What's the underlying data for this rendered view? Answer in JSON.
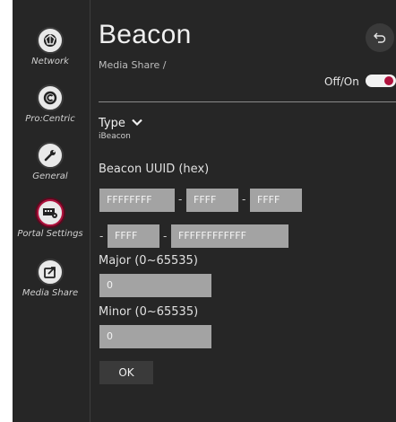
{
  "sidebar": {
    "items": [
      {
        "label": "Network",
        "icon": "network-icon"
      },
      {
        "label": "Pro:Centric",
        "icon": "procentric-icon"
      },
      {
        "label": "General",
        "icon": "wrench-icon"
      },
      {
        "label": "Portal Settings",
        "icon": "portal-settings-icon"
      },
      {
        "label": "Media Share",
        "icon": "media-share-icon"
      }
    ],
    "active_index": 3
  },
  "header": {
    "title": "Beacon",
    "breadcrumb": "Media Share /",
    "toggle_label": "Off/On",
    "toggle_state": "on",
    "back_icon": "back-icon"
  },
  "form": {
    "type_label": "Type",
    "type_value": "iBeacon",
    "uuid_label": "Beacon UUID (hex)",
    "uuid_fields": [
      "FFFFFFFF",
      "FFFF",
      "FFFF",
      "FFFF",
      "FFFFFFFFFFFF"
    ],
    "dash": "-",
    "major_label": "Major (0~65535)",
    "major_value": "0",
    "minor_label": "Minor (0~65535)",
    "minor_value": "0",
    "ok_label": "OK"
  },
  "colors": {
    "accent": "#b0133e",
    "background": "#262626",
    "field": "#a3a3a3"
  }
}
